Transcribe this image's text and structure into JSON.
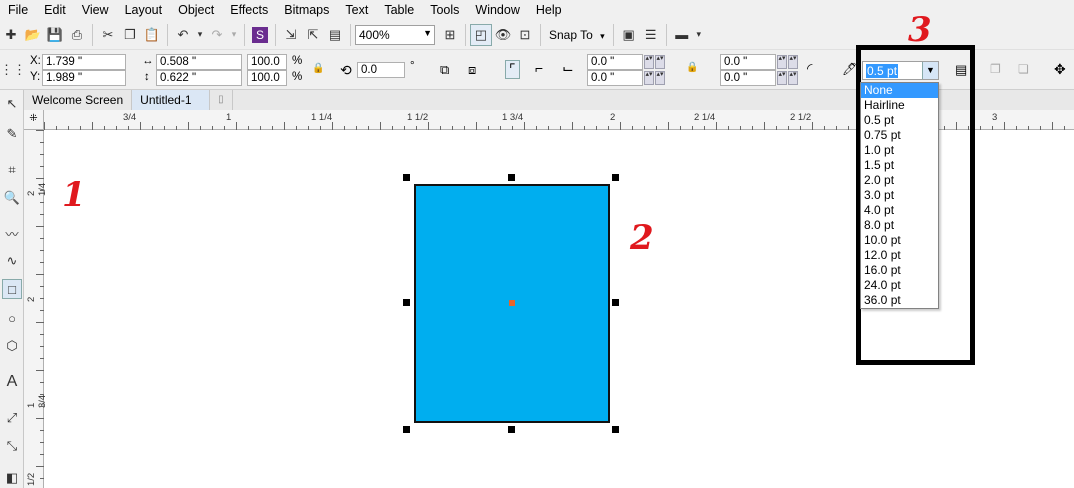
{
  "menu": [
    "File",
    "Edit",
    "View",
    "Layout",
    "Object",
    "Effects",
    "Bitmaps",
    "Text",
    "Table",
    "Tools",
    "Window",
    "Help"
  ],
  "toolbar1": {
    "zoom_value": "400%",
    "snap_label": "Snap To"
  },
  "property_bar": {
    "x_label": "X:",
    "x_value": "1.739 \"",
    "y_label": "Y:",
    "y_value": "1.989 \"",
    "width_value": "0.508 \"",
    "height_value": "0.622 \"",
    "scale_w": "100.0",
    "scale_h": "100.0",
    "percent": "%",
    "rotation_value": "0.0",
    "degree": "°",
    "corner_tl": "0.0 \"",
    "corner_bl": "0.0 \"",
    "corner_tr": "0.0 \"",
    "corner_br": "0.0 \"",
    "outline_width": "0.5 pt"
  },
  "tabs": [
    "Welcome Screen",
    "Untitled-1"
  ],
  "ruler": {
    "h_ticks": [
      "3/4",
      "1",
      "1 1/4",
      "1 1/2",
      "1 3/4",
      "2",
      "2 1/4",
      "2 1/2",
      "3"
    ],
    "v_ticks": [
      "2 1/4",
      "2",
      "1 3/4",
      "1/2"
    ]
  },
  "annotations": [
    "1",
    "2",
    "3"
  ],
  "outline_dropdown": {
    "options": [
      "None",
      "Hairline",
      "0.5 pt",
      "0.75 pt",
      "1.0 pt",
      "1.5 pt",
      "2.0 pt",
      "3.0 pt",
      "4.0 pt",
      "8.0 pt",
      "10.0 pt",
      "12.0 pt",
      "16.0 pt",
      "24.0 pt",
      "36.0 pt"
    ],
    "highlighted": "None"
  },
  "colors": {
    "rect_fill": "#00aeef",
    "annotation": "#e0191e",
    "selection_highlight": "#3399ff"
  }
}
